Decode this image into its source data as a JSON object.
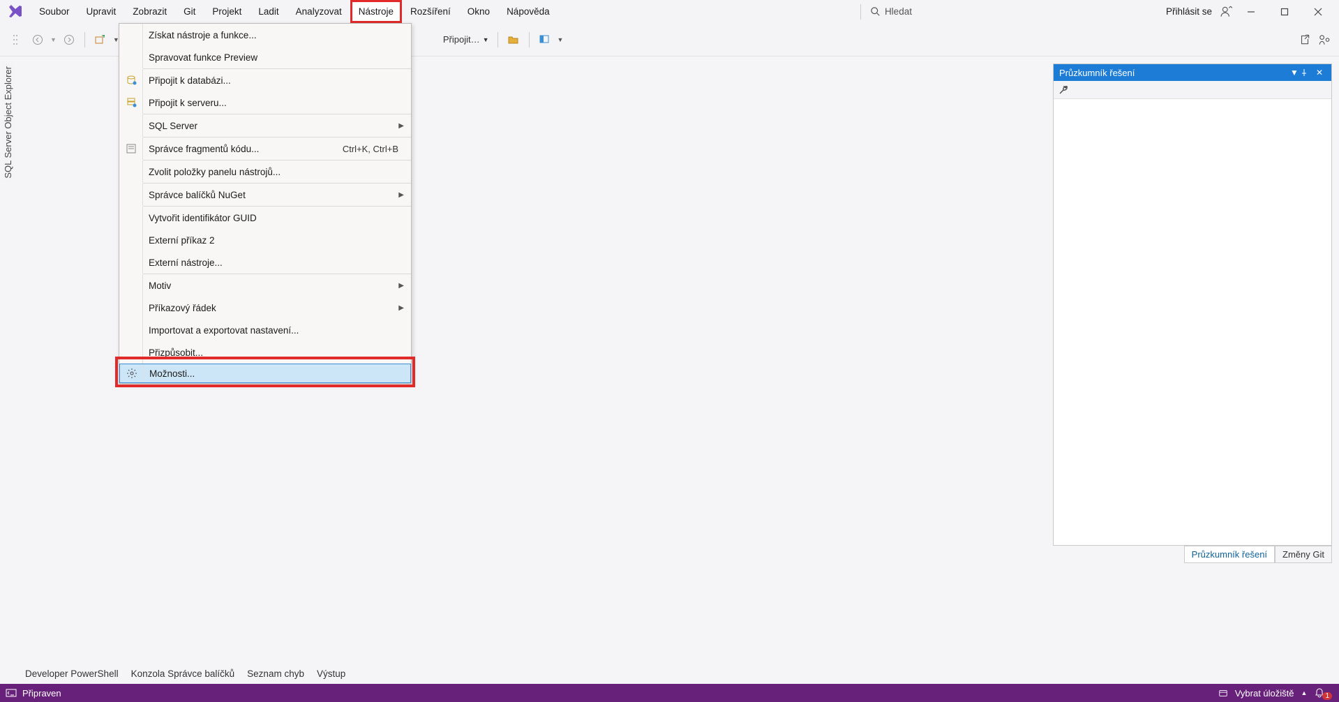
{
  "menu": {
    "items": [
      "Soubor",
      "Upravit",
      "Zobrazit",
      "Git",
      "Projekt",
      "Ladit",
      "Analyzovat",
      "Nástroje",
      "Rozšíření",
      "Okno",
      "Nápověda"
    ],
    "active_index": 7,
    "search_placeholder": "Hledat",
    "signin": "Přihlásit se"
  },
  "toolbar": {
    "attach_label": "Připojit…"
  },
  "dropdown": {
    "items": [
      {
        "label": "Získat nástroje a funkce...",
        "icon": "",
        "sep_after": false
      },
      {
        "label": "Spravovat funkce Preview",
        "icon": "",
        "sep_after": true
      },
      {
        "label": "Připojit k databázi...",
        "icon": "db",
        "sep_after": false
      },
      {
        "label": "Připojit k serveru...",
        "icon": "server",
        "sep_after": true
      },
      {
        "label": "SQL Server",
        "icon": "",
        "submenu": true,
        "sep_after": true
      },
      {
        "label": "Správce fragmentů kódu...",
        "icon": "snippet",
        "shortcut": "Ctrl+K, Ctrl+B",
        "sep_after": true
      },
      {
        "label": "Zvolit položky panelu nástrojů...",
        "icon": "",
        "sep_after": true
      },
      {
        "label": "Správce balíčků NuGet",
        "icon": "",
        "submenu": true,
        "sep_after": true
      },
      {
        "label": "Vytvořit identifikátor GUID",
        "icon": "",
        "sep_after": false
      },
      {
        "label": "Externí příkaz 2",
        "icon": "",
        "sep_after": false
      },
      {
        "label": "Externí nástroje...",
        "icon": "",
        "sep_after": true
      },
      {
        "label": "Motiv",
        "icon": "",
        "submenu": true,
        "sep_after": false
      },
      {
        "label": "Příkazový řádek",
        "icon": "",
        "submenu": true,
        "sep_after": false
      },
      {
        "label": "Importovat a exportovat nastavení...",
        "icon": "",
        "sep_after": false
      },
      {
        "label": "Přizpůsobit...",
        "icon": "",
        "sep_after": false
      },
      {
        "label": "Možnosti...",
        "icon": "gear",
        "highlight": true,
        "sep_after": false
      }
    ]
  },
  "left_rail": {
    "label": "SQL Server Object Explorer"
  },
  "solution_explorer": {
    "title": "Průzkumník řešení",
    "tab_active": "Průzkumník řešení",
    "tab_inactive": "Změny Git"
  },
  "bottom_tabs": [
    "Developer PowerShell",
    "Konzola Správce balíčků",
    "Seznam chyb",
    "Výstup"
  ],
  "statusbar": {
    "ready": "Připraven",
    "repo": "Vybrat úložiště",
    "badge": "1"
  }
}
